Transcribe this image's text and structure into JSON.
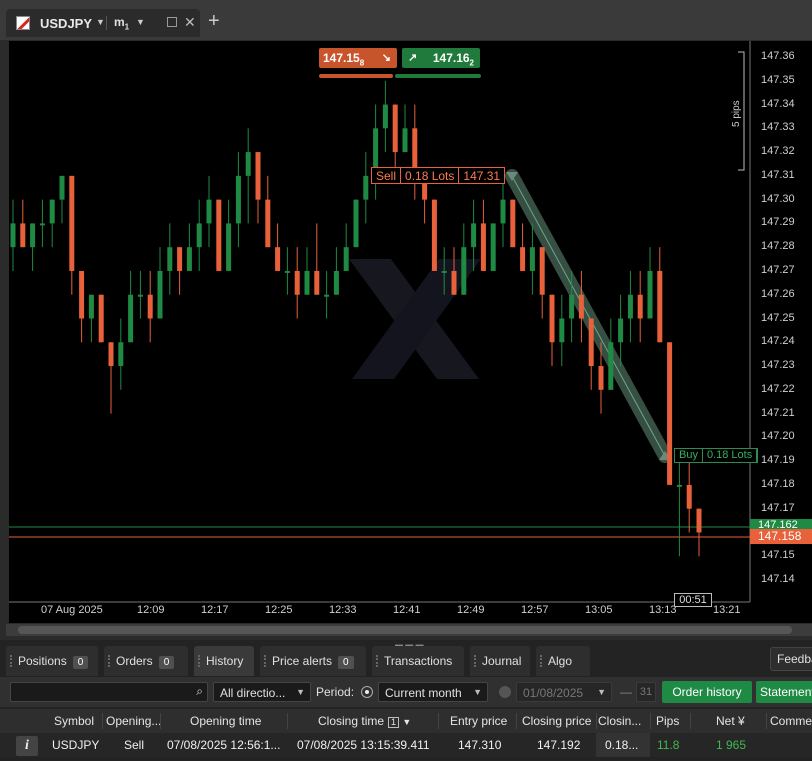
{
  "tab": {
    "symbol": "USDJPY",
    "timeframe": "m1"
  },
  "chart": {
    "sell_quote": "147.158",
    "buy_quote": "147.162",
    "sell_quote_main": "147.15",
    "sell_quote_pip": "8",
    "buy_quote_main": "147.16",
    "buy_quote_pip": "2",
    "sell_order": {
      "side": "Sell",
      "lots": "0.18 Lots",
      "price": "147.31"
    },
    "buy_order": {
      "side": "Buy",
      "lots": "0.18 Lots"
    },
    "pips_label": "5 pips",
    "current_buy_tag": "147.162",
    "current_sell_tag": "147.158",
    "time_cursor": "00:51",
    "colors": {
      "bull": "#1e8a43",
      "bear": "#e8613a",
      "background": "#000000"
    }
  },
  "chart_data": {
    "type": "candlestick",
    "price_axis": [
      "147.36",
      "147.35",
      "147.34",
      "147.33",
      "147.32",
      "147.31",
      "147.30",
      "147.29",
      "147.28",
      "147.27",
      "147.26",
      "147.25",
      "147.24",
      "147.23",
      "147.22",
      "147.21",
      "147.20",
      "147.19",
      "147.18",
      "147.17",
      "147.16",
      "147.15",
      "147.14"
    ],
    "time_axis": [
      "07 Aug 2025",
      "12:09",
      "12:17",
      "12:25",
      "12:33",
      "12:41",
      "12:49",
      "12:57",
      "13:05",
      "13:13",
      "13:21"
    ],
    "ylim": [
      147.135,
      147.37
    ],
    "candles": [
      [
        147.28,
        147.3,
        147.27,
        147.29
      ],
      [
        147.29,
        147.3,
        147.28,
        147.28
      ],
      [
        147.28,
        147.29,
        147.27,
        147.29
      ],
      [
        147.29,
        147.3,
        147.28,
        147.29
      ],
      [
        147.29,
        147.3,
        147.28,
        147.3
      ],
      [
        147.3,
        147.31,
        147.29,
        147.31
      ],
      [
        147.31,
        147.31,
        147.26,
        147.27
      ],
      [
        147.27,
        147.27,
        147.24,
        147.25
      ],
      [
        147.25,
        147.26,
        147.24,
        147.26
      ],
      [
        147.26,
        147.26,
        147.24,
        147.24
      ],
      [
        147.24,
        147.24,
        147.21,
        147.23
      ],
      [
        147.23,
        147.25,
        147.22,
        147.24
      ],
      [
        147.24,
        147.27,
        147.24,
        147.26
      ],
      [
        147.26,
        147.27,
        147.25,
        147.26
      ],
      [
        147.26,
        147.27,
        147.24,
        147.25
      ],
      [
        147.25,
        147.28,
        147.25,
        147.27
      ],
      [
        147.27,
        147.29,
        147.26,
        147.28
      ],
      [
        147.28,
        147.28,
        147.26,
        147.27
      ],
      [
        147.27,
        147.29,
        147.27,
        147.28
      ],
      [
        147.28,
        147.3,
        147.27,
        147.29
      ],
      [
        147.29,
        147.31,
        147.28,
        147.3
      ],
      [
        147.3,
        147.3,
        147.27,
        147.27
      ],
      [
        147.27,
        147.3,
        147.27,
        147.29
      ],
      [
        147.29,
        147.32,
        147.28,
        147.31
      ],
      [
        147.31,
        147.33,
        147.29,
        147.32
      ],
      [
        147.32,
        147.32,
        147.29,
        147.3
      ],
      [
        147.3,
        147.31,
        147.28,
        147.28
      ],
      [
        147.28,
        147.29,
        147.27,
        147.27
      ],
      [
        147.27,
        147.28,
        147.26,
        147.27
      ],
      [
        147.27,
        147.28,
        147.25,
        147.26
      ],
      [
        147.26,
        147.28,
        147.26,
        147.27
      ],
      [
        147.27,
        147.29,
        147.26,
        147.26
      ],
      [
        147.26,
        147.27,
        147.25,
        147.26
      ],
      [
        147.26,
        147.28,
        147.26,
        147.27
      ],
      [
        147.27,
        147.29,
        147.27,
        147.28
      ],
      [
        147.28,
        147.3,
        147.28,
        147.3
      ],
      [
        147.3,
        147.32,
        147.29,
        147.31
      ],
      [
        147.31,
        147.34,
        147.3,
        147.33
      ],
      [
        147.33,
        147.35,
        147.32,
        147.34
      ],
      [
        147.34,
        147.34,
        147.31,
        147.32
      ],
      [
        147.32,
        147.34,
        147.32,
        147.33
      ],
      [
        147.33,
        147.34,
        147.3,
        147.31
      ],
      [
        147.31,
        147.31,
        147.29,
        147.3
      ],
      [
        147.3,
        147.3,
        147.27,
        147.27
      ],
      [
        147.27,
        147.28,
        147.26,
        147.27
      ],
      [
        147.27,
        147.28,
        147.26,
        147.26
      ],
      [
        147.26,
        147.29,
        147.26,
        147.28
      ],
      [
        147.28,
        147.3,
        147.27,
        147.29
      ],
      [
        147.29,
        147.3,
        147.27,
        147.27
      ],
      [
        147.27,
        147.29,
        147.27,
        147.29
      ],
      [
        147.29,
        147.31,
        147.28,
        147.3
      ],
      [
        147.3,
        147.3,
        147.28,
        147.28
      ],
      [
        147.28,
        147.29,
        147.27,
        147.27
      ],
      [
        147.27,
        147.29,
        147.26,
        147.28
      ],
      [
        147.28,
        147.28,
        147.25,
        147.26
      ],
      [
        147.26,
        147.26,
        147.23,
        147.24
      ],
      [
        147.24,
        147.26,
        147.23,
        147.25
      ],
      [
        147.25,
        147.27,
        147.24,
        147.26
      ],
      [
        147.26,
        147.27,
        147.24,
        147.25
      ],
      [
        147.25,
        147.25,
        147.22,
        147.23
      ],
      [
        147.23,
        147.24,
        147.21,
        147.22
      ],
      [
        147.22,
        147.25,
        147.22,
        147.24
      ],
      [
        147.24,
        147.26,
        147.23,
        147.25
      ],
      [
        147.25,
        147.27,
        147.24,
        147.26
      ],
      [
        147.26,
        147.27,
        147.24,
        147.25
      ],
      [
        147.25,
        147.28,
        147.25,
        147.27
      ],
      [
        147.27,
        147.28,
        147.24,
        147.24
      ],
      [
        147.24,
        147.24,
        147.18,
        147.18
      ],
      [
        147.18,
        147.19,
        147.15,
        147.18
      ],
      [
        147.18,
        147.19,
        147.16,
        147.17
      ],
      [
        147.17,
        147.17,
        147.15,
        147.16
      ]
    ]
  },
  "bottom": {
    "tabs": [
      {
        "label": "Positions",
        "badge": "0"
      },
      {
        "label": "Orders",
        "badge": "0"
      },
      {
        "label": "History"
      },
      {
        "label": "Price alerts",
        "badge": "0"
      },
      {
        "label": "Transactions"
      },
      {
        "label": "Journal"
      },
      {
        "label": "Algo"
      }
    ],
    "feedback": "Feedback",
    "direction": "All directio...",
    "period_label": "Period:",
    "period_value": "Current month",
    "date_value": "01/08/2025",
    "calendar_day": "31",
    "order_history": "Order history",
    "statement": "Statement",
    "columns": [
      "Symbol",
      "Opening...",
      "Opening time",
      "Closing time",
      "Entry price",
      "Closing price",
      "Closin...",
      "Pips",
      "Net ¥",
      "Comme..."
    ],
    "sort_indicator": "1",
    "row": {
      "symbol": "USDJPY",
      "direction": "Sell",
      "opening_time": "07/08/2025 12:56:1...",
      "closing_time": "07/08/2025 13:15:39.411",
      "entry_price": "147.310",
      "closing_price": "147.192",
      "closing_volume": "0.18...",
      "pips": "11.8",
      "net": "1 965"
    }
  }
}
